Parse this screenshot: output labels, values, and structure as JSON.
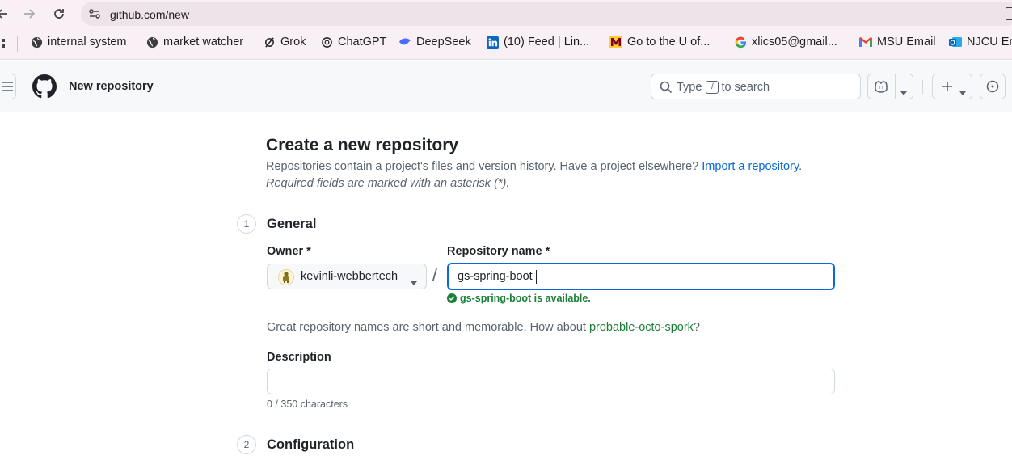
{
  "browser": {
    "url": "github.com/new",
    "bookmarks": [
      {
        "label": "internal system",
        "icon": "globe-icon"
      },
      {
        "label": "market watcher",
        "icon": "globe-icon"
      },
      {
        "label": "Grok",
        "icon": "grok-icon"
      },
      {
        "label": "ChatGPT",
        "icon": "chatgpt-icon"
      },
      {
        "label": "DeepSeek",
        "icon": "deepseek-icon"
      },
      {
        "label": "(10) Feed | Lin...",
        "icon": "linkedin-icon"
      },
      {
        "label": "Go to the U of...",
        "icon": "umn-icon"
      },
      {
        "label": "xlics05@gmail...",
        "icon": "google-icon"
      },
      {
        "label": "MSU Email",
        "icon": "gmail-icon"
      },
      {
        "label": "NJCU Em",
        "icon": "outlook-icon"
      }
    ]
  },
  "header": {
    "context_title": "New repository",
    "search_placeholder_before": "Type",
    "search_key": "/",
    "search_placeholder_after": "to search"
  },
  "page": {
    "title": "Create a new repository",
    "intro": "Repositories contain a project's files and version history. Have a project elsewhere?",
    "import_link": "Import a repository",
    "intro_end": ".",
    "required_note": "Required fields are marked with an asterisk (*)."
  },
  "general": {
    "step": "1",
    "title": "General",
    "owner_label": "Owner *",
    "owner_value": "kevinli-webbertech",
    "slash": "/",
    "repo_label": "Repository name *",
    "repo_value": "gs-spring-boot",
    "availability": "gs-spring-boot is available.",
    "suggestion_prefix": "Great repository names are short and memorable. How about",
    "suggestion_name": "probable-octo-spork",
    "suggestion_suffix": "?",
    "description_label": "Description",
    "description_value": "",
    "description_counter": "0 / 350 characters"
  },
  "configuration": {
    "step": "2",
    "title": "Configuration"
  },
  "colors": {
    "accent": "#0969da",
    "success": "#1a7f37",
    "muted": "#59636e"
  }
}
